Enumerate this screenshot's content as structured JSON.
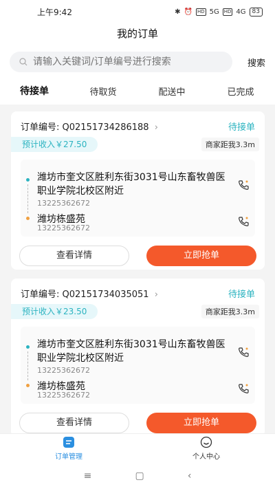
{
  "status_bar": {
    "time": "上午9:42",
    "signal1": "5G",
    "signal2": "4G",
    "battery": "83",
    "hd": "HD"
  },
  "header": {
    "title": "我的订单"
  },
  "search": {
    "placeholder": "请输入关键词/订单编号进行搜索",
    "button": "搜索"
  },
  "tabs": [
    {
      "label": "待接单",
      "active": true
    },
    {
      "label": "待取货",
      "active": false
    },
    {
      "label": "配送中",
      "active": false
    },
    {
      "label": "已完成",
      "active": false
    }
  ],
  "orders": [
    {
      "order_label": "订单编号:",
      "order_no": "Q02151734286188",
      "status": "待接单",
      "income": "预计收入￥27.50",
      "distance": "商家距我3.3m",
      "pickup_address": "潍坊市奎文区胜利东街3031号山东畜牧兽医职业学院北校区附近",
      "pickup_phone": "13225362672",
      "delivery_address": "潍坊栋盛苑",
      "delivery_phone": "13225362672",
      "detail_button": "查看详情",
      "grab_button": "立即抢单"
    },
    {
      "order_label": "订单编号:",
      "order_no": "Q02151734035051",
      "status": "待接单",
      "income": "预计收入￥23.50",
      "distance": "商家距我3.3m",
      "pickup_address": "潍坊市奎文区胜利东街3031号山东畜牧兽医职业学院北校区附近",
      "pickup_phone": "13225362672",
      "delivery_address": "潍坊栋盛苑",
      "delivery_phone": "13225362672",
      "detail_button": "查看详情",
      "grab_button": "立即抢单"
    }
  ],
  "bottom_nav": [
    {
      "label": "订单管理",
      "icon": "order-management-icon",
      "active": true
    },
    {
      "label": "个人中心",
      "icon": "profile-icon",
      "active": false
    }
  ],
  "colors": {
    "accent": "#2bb3c0",
    "grab": "#f4592b",
    "nav_active": "#2b8fe0"
  }
}
